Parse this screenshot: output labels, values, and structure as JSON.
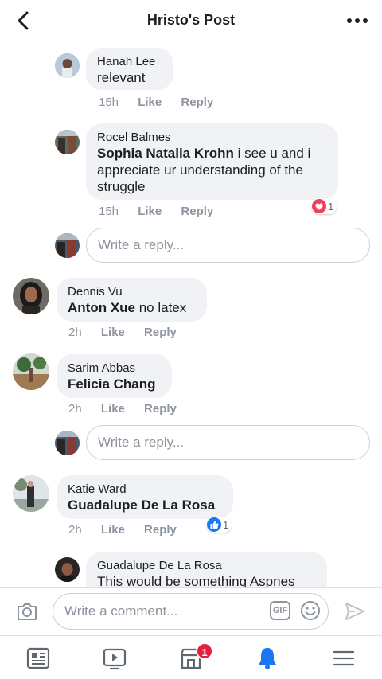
{
  "header": {
    "title": "Hristo's Post"
  },
  "comments": [
    {
      "name": "Hanah Lee",
      "mention": "",
      "text": "relevant",
      "time": "15h",
      "like": "Like",
      "reply": "Reply"
    },
    {
      "name": "Rocel Balmes",
      "mention": "Sophia Natalia Krohn",
      "text_line1": " i see u and i",
      "text_line2": "appreciate ur understanding of the",
      "text_line3": "struggle",
      "time": "15h",
      "like": "Like",
      "reply": "Reply",
      "reaction_count": "1"
    },
    {
      "name": "Dennis Vu",
      "mention": "Anton Xue",
      "text": " no latex",
      "time": "2h",
      "like": "Like",
      "reply": "Reply"
    },
    {
      "name": "Sarim Abbas",
      "mention": "Felicia Chang",
      "text": "",
      "time": "2h",
      "like": "Like",
      "reply": "Reply"
    },
    {
      "name": "Katie Ward",
      "mention": "Guadalupe De La Rosa",
      "text": "",
      "time": "2h",
      "like": "Like",
      "reply": "Reply",
      "reaction_count": "1"
    },
    {
      "name": "Guadalupe De La Rosa",
      "mention": "",
      "text": "This would be something Aspnes"
    }
  ],
  "reply_placeholder": "Write a reply...",
  "composer": {
    "placeholder": "Write a comment...",
    "gif_label": "GIF"
  },
  "nav": {
    "notification_badge": "1"
  },
  "colors": {
    "accent": "#1877f2",
    "badge": "#e41e3f",
    "love": "#f33e58"
  }
}
